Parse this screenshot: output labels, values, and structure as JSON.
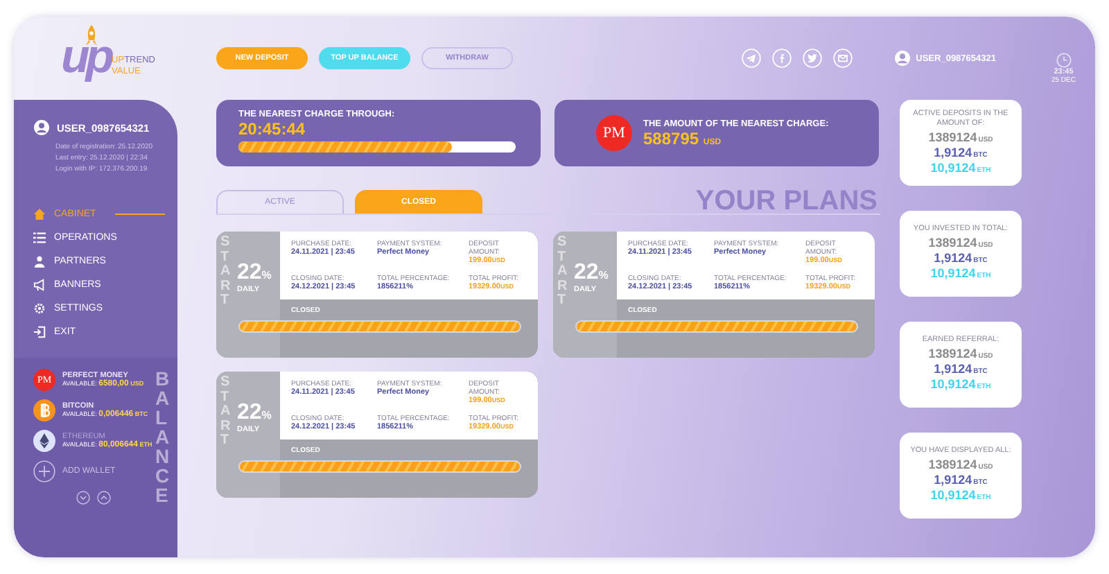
{
  "logo": {
    "mark": "up",
    "brand_accent": "UP",
    "brand_rest": "TREND",
    "brand_line2": "VALUE"
  },
  "header": {
    "buttons": [
      {
        "label": "NEW DEPOSIT",
        "kind": "primary"
      },
      {
        "label": "TOP UP BALANCE",
        "kind": "secondary"
      },
      {
        "label": "WITHDRAW",
        "kind": "disabled"
      }
    ],
    "user": "USER_0987654321",
    "time": "23:45",
    "date": "25 DEC"
  },
  "sidebar": {
    "user": "USER_0987654321",
    "info": [
      "Date of registration: 25.12.2020",
      "Last entry: 25.12.2020 | 22:34",
      "Login with IP: 172.376.200.19"
    ],
    "items": [
      {
        "label": "CABINET",
        "kind": "home",
        "selected": true
      },
      {
        "label": "OPERATIONS",
        "kind": "list",
        "selected": false
      },
      {
        "label": "PARTNERS",
        "kind": "people",
        "selected": false
      },
      {
        "label": "BANNERS",
        "kind": "megaphone",
        "selected": false
      },
      {
        "label": "SETTINGS",
        "kind": "gear",
        "selected": false
      },
      {
        "label": "EXIT",
        "kind": "exit",
        "selected": false
      }
    ],
    "balance_title": "BALANCE",
    "wallets": [
      {
        "kind": "pm",
        "logo_text": "PM",
        "name": "PERFECT MONEY",
        "available_label": "AVAILABLE:",
        "amount": "6580,00",
        "unit": "USD",
        "dimmed": false
      },
      {
        "kind": "bitcoin",
        "name": "BITCOIN",
        "available_label": "AVAILABLE:",
        "amount": "0,006446",
        "unit": "BTC",
        "dimmed": false
      },
      {
        "kind": "ethereum",
        "name": "ETHEREUM",
        "available_label": "AVAILABLE:",
        "amount": "80,006644",
        "unit": "ETH",
        "dimmed": true
      }
    ],
    "add_wallet": "ADD WALLET"
  },
  "charge": {
    "title": "THE NEAREST CHARGE THROUGH:",
    "value": "20:45:44",
    "level": 0.77
  },
  "amount": {
    "logo_text": "PM",
    "title": "THE AMOUNT OF THE NEAREST CHARGE:",
    "value": "588795",
    "unit": "USD"
  },
  "tabs": [
    {
      "label": "ACTIVE",
      "selected": false
    },
    {
      "label": "CLOSED",
      "selected": true
    }
  ],
  "section_title": "YOUR PLANS",
  "plans": [
    {
      "side_text": "START",
      "percent": "22",
      "percent_sign": "%",
      "period": "DAILY",
      "fields": [
        {
          "label": "PURCHASE DATE:",
          "value": "24.11.2021 | 23:45",
          "kind": "date"
        },
        {
          "label": "PAYMENT SYSTEM:",
          "value": "Perfect Money",
          "kind": "date"
        },
        {
          "label": "DEPOSIT AMOUNT:",
          "value": "199.00",
          "unit": "USD",
          "kind": "money"
        },
        {
          "label": "CLOSING DATE:",
          "value": "24.12.2021 | 23:45",
          "kind": "date"
        },
        {
          "label": "TOTAL PERCENTAGE:",
          "value": "1856211%",
          "kind": "date"
        },
        {
          "label": "TOTAL PROFIT:",
          "value": "19329.00",
          "unit": "USD",
          "kind": "money"
        }
      ],
      "status": "CLOSED",
      "level": 1
    },
    {
      "side_text": "START",
      "percent": "22",
      "percent_sign": "%",
      "period": "DAILY",
      "fields": [
        {
          "label": "PURCHASE DATE:",
          "value": "24.11.2021 | 23:45",
          "kind": "date"
        },
        {
          "label": "PAYMENT SYSTEM:",
          "value": "Perfect Money",
          "kind": "date"
        },
        {
          "label": "DEPOSIT AMOUNT:",
          "value": "199.00",
          "unit": "USD",
          "kind": "money"
        },
        {
          "label": "CLOSING DATE:",
          "value": "24.12.2021 | 23:45",
          "kind": "date"
        },
        {
          "label": "TOTAL PERCENTAGE:",
          "value": "1856211%",
          "kind": "date"
        },
        {
          "label": "TOTAL PROFIT:",
          "value": "19329.00",
          "unit": "USD",
          "kind": "money"
        }
      ],
      "status": "CLOSED",
      "level": 1
    },
    {
      "side_text": "START",
      "percent": "22",
      "percent_sign": "%",
      "period": "DAILY",
      "fields": [
        {
          "label": "PURCHASE DATE:",
          "value": "24.11.2021 | 23:45",
          "kind": "date"
        },
        {
          "label": "PAYMENT SYSTEM:",
          "value": "Perfect Money",
          "kind": "date"
        },
        {
          "label": "DEPOSIT AMOUNT:",
          "value": "199.00",
          "unit": "USD",
          "kind": "money"
        },
        {
          "label": "CLOSING DATE:",
          "value": "24.12.2021 | 23:45",
          "kind": "date"
        },
        {
          "label": "TOTAL PERCENTAGE:",
          "value": "1856211%",
          "kind": "date"
        },
        {
          "label": "TOTAL PROFIT:",
          "value": "19329.00",
          "unit": "USD",
          "kind": "money"
        }
      ],
      "status": "CLOSED",
      "level": 1
    }
  ],
  "stats": [
    {
      "title": "ACTIVE DEPOSITS IN THE AMOUNT OF:",
      "amounts": [
        {
          "value": "1389124",
          "unit": "USD",
          "kind": "usd"
        },
        {
          "value": "1,9124",
          "unit": "BTC",
          "kind": "btc"
        },
        {
          "value": "10,9124",
          "unit": "ETH",
          "kind": "eth"
        }
      ]
    },
    {
      "title": "YOU INVESTED IN TOTAL:",
      "amounts": [
        {
          "value": "1389124",
          "unit": "USD",
          "kind": "usd"
        },
        {
          "value": "1,9124",
          "unit": "BTC",
          "kind": "btc"
        },
        {
          "value": "10,9124",
          "unit": "ETH",
          "kind": "eth"
        }
      ]
    },
    {
      "title": "EARNED REFERRAL:",
      "amounts": [
        {
          "value": "1389124",
          "unit": "USD",
          "kind": "usd"
        },
        {
          "value": "1,9124",
          "unit": "BTC",
          "kind": "btc"
        },
        {
          "value": "10,9124",
          "unit": "ETH",
          "kind": "eth"
        }
      ]
    },
    {
      "title": "YOU HAVE DISPLAYED ALL:",
      "amounts": [
        {
          "value": "1389124",
          "unit": "USD",
          "kind": "usd"
        },
        {
          "value": "1,9124",
          "unit": "BTC",
          "kind": "btc"
        },
        {
          "value": "10,9124",
          "unit": "ETH",
          "kind": "eth"
        }
      ]
    }
  ]
}
